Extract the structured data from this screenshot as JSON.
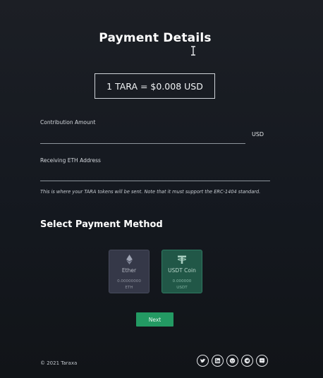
{
  "page": {
    "title": "Payment Details",
    "rate": "1 TARA = $0.008 USD"
  },
  "form": {
    "contribution_label": "Contribution Amount",
    "contribution_value": "",
    "contribution_unit": "USD",
    "eth_address_label": "Receiving ETH Address",
    "eth_address_value": "",
    "hint": "This is where your TARA tokens will be sent. Note that it must support the ERC-1404 standard."
  },
  "payment": {
    "section_title": "Select Payment Method",
    "methods": [
      {
        "name": "Ether",
        "amount": "0.00000000",
        "unit": "ETH",
        "icon": "ethereum-icon"
      },
      {
        "name": "USDT Coin",
        "amount": "0.000000",
        "unit": "USDT",
        "icon": "tether-icon"
      }
    ]
  },
  "actions": {
    "next_label": "Next"
  },
  "footer": {
    "copyright": "© 2021 Taraxa",
    "socials": [
      "twitter-icon",
      "linkedin-icon",
      "reddit-icon",
      "telegram-icon",
      "discord-icon"
    ]
  },
  "colors": {
    "background": "#161a20",
    "accent_green": "#239a63",
    "ether_card": "#353848",
    "usdt_card": "#215747"
  }
}
